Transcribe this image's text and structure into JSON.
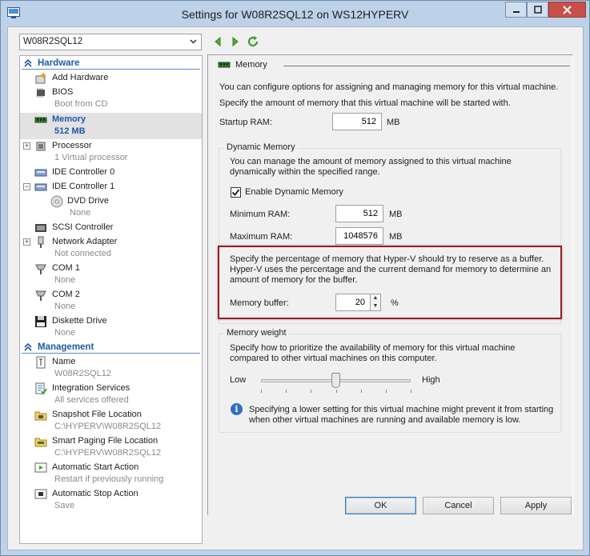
{
  "window": {
    "title": "Settings for W08R2SQL12 on WS12HYPERV",
    "controls": [
      "minimize-icon",
      "maximize-icon",
      "close-icon"
    ]
  },
  "vm_selector": {
    "value": "W08R2SQL12"
  },
  "tree": {
    "hardware": {
      "heading": "Hardware",
      "items": [
        {
          "name": "Add Hardware",
          "sub": ""
        },
        {
          "name": "BIOS",
          "sub": "Boot from CD"
        },
        {
          "name": "Memory",
          "sub": "512 MB"
        },
        {
          "name": "Processor",
          "sub": "1 Virtual processor"
        },
        {
          "name": "IDE Controller 0",
          "sub": ""
        },
        {
          "name": "IDE Controller 1",
          "sub": ""
        },
        {
          "name": "DVD Drive",
          "sub": "None"
        },
        {
          "name": "SCSI Controller",
          "sub": ""
        },
        {
          "name": "Network Adapter",
          "sub": "Not connected"
        },
        {
          "name": "COM 1",
          "sub": "None"
        },
        {
          "name": "COM 2",
          "sub": "None"
        },
        {
          "name": "Diskette Drive",
          "sub": "None"
        }
      ]
    },
    "management": {
      "heading": "Management",
      "items": [
        {
          "name": "Name",
          "sub": "W08R2SQL12"
        },
        {
          "name": "Integration Services",
          "sub": "All services offered"
        },
        {
          "name": "Snapshot File Location",
          "sub": "C:\\HYPERV\\W08R2SQL12"
        },
        {
          "name": "Smart Paging File Location",
          "sub": "C:\\HYPERV\\W08R2SQL12"
        },
        {
          "name": "Automatic Start Action",
          "sub": "Restart if previously running"
        },
        {
          "name": "Automatic Stop Action",
          "sub": "Save"
        }
      ]
    }
  },
  "memory_panel": {
    "title": "Memory",
    "intro1": "You can configure options for assigning and managing memory for this virtual machine.",
    "intro2": "Specify the amount of memory that this virtual machine will be started with.",
    "startup_label": "Startup RAM:",
    "startup_value": "512",
    "startup_unit": "MB",
    "dynamic": {
      "title": "Dynamic Memory",
      "desc": "You can manage the amount of memory assigned to this virtual machine dynamically within the specified range.",
      "enable_label": "Enable Dynamic Memory",
      "enabled": true,
      "min_label": "Minimum RAM:",
      "min_value": "512",
      "max_label": "Maximum RAM:",
      "max_value": "1048576",
      "unit": "MB",
      "buffer_desc": "Specify the percentage of memory that Hyper-V should try to reserve as a buffer. Hyper-V uses the percentage and the current demand for memory to determine an amount of memory for the buffer.",
      "buffer_label": "Memory buffer:",
      "buffer_value": "20",
      "buffer_unit": "%"
    },
    "weight": {
      "title": "Memory weight",
      "desc": "Specify how to prioritize the availability of memory for this virtual machine compared to other virtual machines on this computer.",
      "low_label": "Low",
      "high_label": "High",
      "level": 0.5,
      "info": "Specifying a lower setting for this virtual machine might prevent it from starting when other virtual machines are running and available memory is low."
    }
  },
  "buttons": {
    "ok": "OK",
    "cancel": "Cancel",
    "apply": "Apply"
  },
  "colors": {
    "accent": "#1e5aa8",
    "highlight_border": "#9a1c20",
    "close_button": "#c7504a"
  }
}
